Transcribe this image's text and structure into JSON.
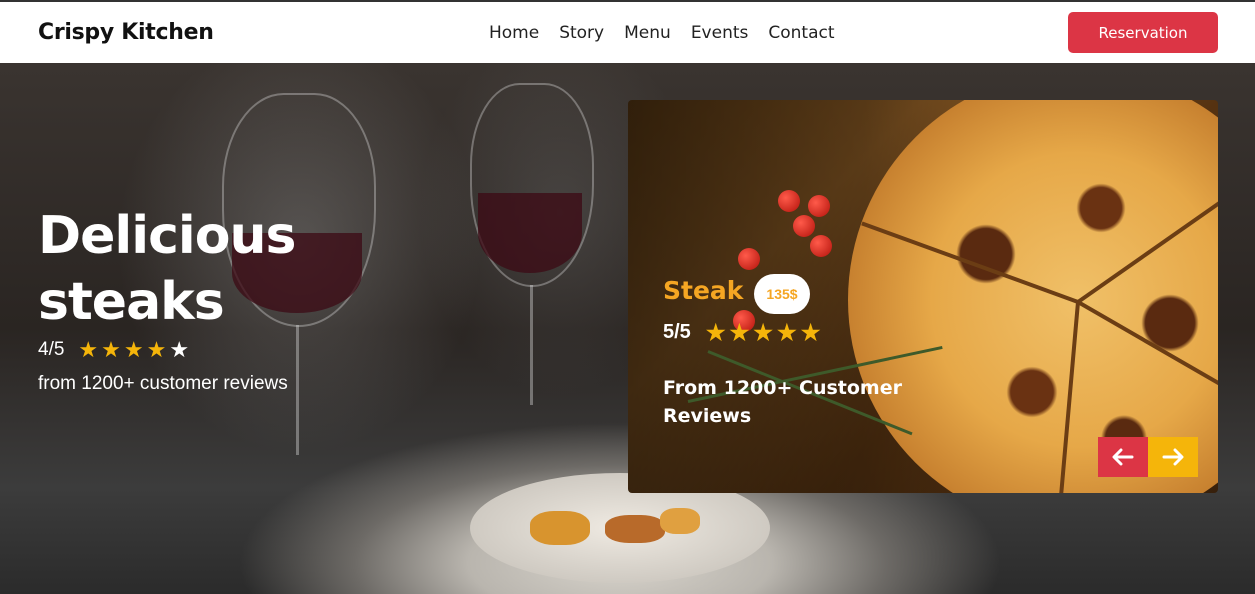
{
  "header": {
    "brand": "Crispy Kitchen",
    "nav": [
      "Home",
      "Story",
      "Menu",
      "Events",
      "Contact"
    ],
    "reservation_label": "Reservation"
  },
  "hero": {
    "title": "Delicious steaks",
    "rating_text": "4/5",
    "rating_value": 4,
    "rating_max": 5,
    "reviews_text": "from 1200+ customer reviews"
  },
  "card": {
    "title": "Steak",
    "price": "135$",
    "rating_text": "5/5",
    "rating_value": 5,
    "rating_max": 5,
    "reviews_text": "From 1200+ Customer Reviews",
    "prev_icon": "arrow-left",
    "next_icon": "arrow-right"
  },
  "colors": {
    "accent_red": "#dc3545",
    "accent_gold": "#f5b50a",
    "card_title": "#f5a623"
  }
}
